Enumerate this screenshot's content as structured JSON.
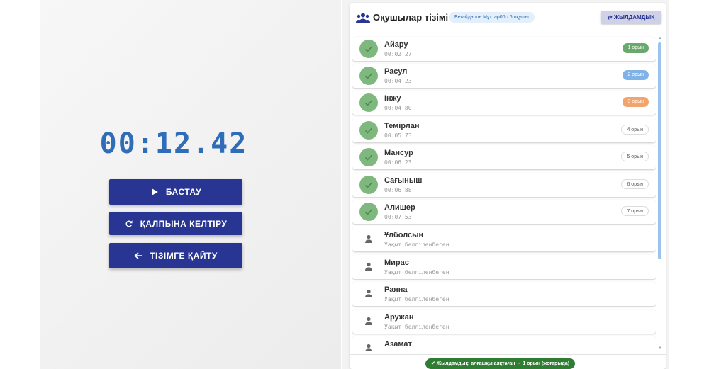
{
  "timer": {
    "display": "00:12.42"
  },
  "controls": {
    "start_label": "БАСТАУ",
    "reset_label": "ҚАЛПЫНА КЕЛТІРУ",
    "back_label": "ТІЗІМГЕ ҚАЙТУ"
  },
  "panel": {
    "title": "Оқушылар тізімі",
    "badge": "Бегайдаров Мұхтар00 · 6 оқушы",
    "sort_label": "⇄ ЖЫЛДАМДЫҚ",
    "footer_note": "✔ Жылдамдық: алғашқы аяқтаған → 1 орын (жоғарыда)"
  },
  "students": [
    {
      "name": "Айару",
      "time": "00:02.27",
      "rank": "1 орын"
    },
    {
      "name": "Расул",
      "time": "00:04.23",
      "rank": "2 орын"
    },
    {
      "name": "Інжу",
      "time": "00:04.80",
      "rank": "3 орын"
    },
    {
      "name": "Темірлан",
      "time": "00:05.73",
      "rank": "4 орын"
    },
    {
      "name": "Мансур",
      "time": "00:06.23",
      "rank": "5 орын"
    },
    {
      "name": "Сағыныш",
      "time": "00:06.88",
      "rank": "6 орын"
    },
    {
      "name": "Алишер",
      "time": "00:07.53",
      "rank": "7 орын"
    },
    {
      "name": "Ұлболсын",
      "time": "Уақыт белгіленбеген",
      "rank": ""
    },
    {
      "name": "Мирас",
      "time": "Уақыт белгіленбеген",
      "rank": ""
    },
    {
      "name": "Раяна",
      "time": "Уақыт белгіленбеген",
      "rank": ""
    },
    {
      "name": "Аружан",
      "time": "Уақыт белгіленбеген",
      "rank": ""
    },
    {
      "name": "Азамат",
      "time": "",
      "rank": ""
    }
  ],
  "colors": {
    "primary": "#283593",
    "timer": "#2f6db8",
    "done": "#7fb87f"
  }
}
